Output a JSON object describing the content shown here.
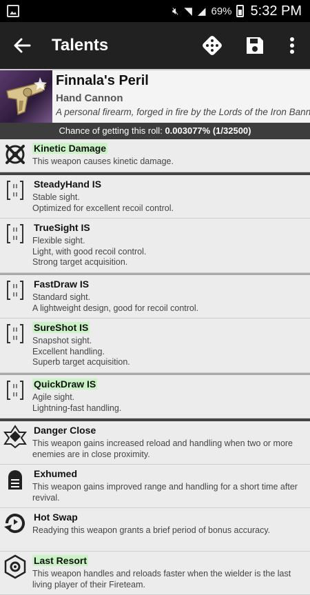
{
  "status_bar": {
    "battery_pct": "69%",
    "time": "5:32 PM"
  },
  "appbar": {
    "title": "Talents"
  },
  "weapon": {
    "name": "Finnala's Peril",
    "type": "Hand Cannon",
    "description": "A personal firearm, forged in fire by the Lords of the Iron Bann"
  },
  "chance": {
    "label": "Chance of getting this roll:",
    "value": "0.003077% (1/32500)"
  },
  "perks": [
    {
      "name": "Kinetic Damage",
      "desc": [
        "This weapon causes kinetic damage."
      ],
      "highlight": true,
      "icon": "kinetic-icon"
    },
    {
      "name": "SteadyHand IS",
      "desc": [
        "Stable sight.",
        "Optimized for excellent recoil control."
      ],
      "highlight": false,
      "icon": "sight-icon"
    },
    {
      "name": "TrueSight IS",
      "desc": [
        "Flexible sight.",
        "Light, with good recoil control.",
        "Strong target acquisition."
      ],
      "highlight": false,
      "icon": "sight-icon"
    },
    {
      "name": "FastDraw IS",
      "desc": [
        "Standard sight.",
        "A lightweight design, good for recoil control."
      ],
      "highlight": false,
      "icon": "sight-icon"
    },
    {
      "name": "SureShot IS",
      "desc": [
        "Snapshot sight.",
        "Excellent handling.",
        "Superb target acquisition."
      ],
      "highlight": true,
      "icon": "sight-icon"
    },
    {
      "name": "QuickDraw IS",
      "desc": [
        "Agile sight.",
        "Lightning-fast handling."
      ],
      "highlight": true,
      "icon": "sight-icon"
    },
    {
      "name": "Danger Close",
      "desc": [
        "This weapon gains increased reload and handling when two or more enemies are in close proximity."
      ],
      "highlight": false,
      "icon": "danger-close-icon"
    },
    {
      "name": "Exhumed",
      "desc": [
        "This weapon gains improved range and handling for a short time after revival."
      ],
      "highlight": false,
      "icon": "exhumed-icon"
    },
    {
      "name": "Hot Swap",
      "desc": [
        "Readying this weapon grants a brief period of bonus accuracy."
      ],
      "highlight": false,
      "icon": "hot-swap-icon"
    },
    {
      "name": "Last Resort",
      "desc": [
        "This weapon handles and reloads faster when the wielder is the last living player of their Fireteam."
      ],
      "highlight": true,
      "icon": "last-resort-icon"
    }
  ]
}
